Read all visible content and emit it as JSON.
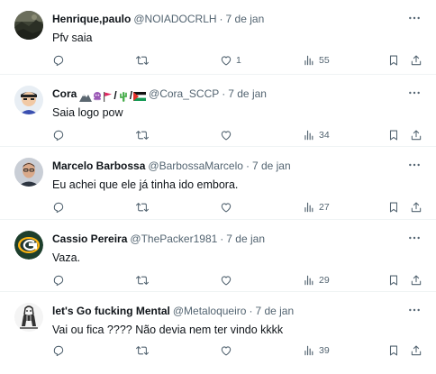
{
  "replies": [
    {
      "name": "Henrique,paulo",
      "handle": "@NOIADOCRLH",
      "separator": "·",
      "date": "7 de jan",
      "text": "Pfv saia",
      "replies_count": "",
      "retweets_count": "",
      "likes_count": "1",
      "views_count": "55",
      "avatar_icon": "landscape-photo-avatar"
    },
    {
      "name": "Cora",
      "handle": "@Cora_SCCP",
      "separator": "·",
      "date": "7 de jan",
      "text": "Saia logo pow",
      "replies_count": "",
      "retweets_count": "",
      "likes_count": "",
      "views_count": "34",
      "avatar_icon": "cartoon-character-avatar",
      "name_emojis": [
        "mountain-icon",
        "octopus-icon",
        "red-flag-icon",
        "cactus-icon",
        "palestine-flag-icon"
      ],
      "emoji_slash": "/"
    },
    {
      "name": "Marcelo Barbossa",
      "handle": "@BarbossaMarcelo",
      "separator": "·",
      "date": "7 de jan",
      "text": "Eu achei que ele já tinha ido embora.",
      "replies_count": "",
      "retweets_count": "",
      "likes_count": "",
      "views_count": "27",
      "avatar_icon": "man-portrait-avatar"
    },
    {
      "name": "Cassio Pereira",
      "handle": "@ThePacker1981",
      "separator": "·",
      "date": "7 de jan",
      "text": "Vaza.",
      "replies_count": "",
      "retweets_count": "",
      "likes_count": "",
      "views_count": "29",
      "avatar_icon": "green-bay-logo-avatar"
    },
    {
      "name": "let's Go fucking Mental",
      "handle": "@Metaloqueiro",
      "separator": "·",
      "date": "7 de jan",
      "text": "Vai ou fica ???? Não devia nem ter vindo kkkk",
      "replies_count": "",
      "retweets_count": "",
      "likes_count": "",
      "views_count": "39",
      "avatar_icon": "sketch-drawing-avatar"
    }
  ],
  "colors": {
    "text_primary": "#0f1419",
    "text_secondary": "#536471",
    "divider": "#eff3f4"
  }
}
